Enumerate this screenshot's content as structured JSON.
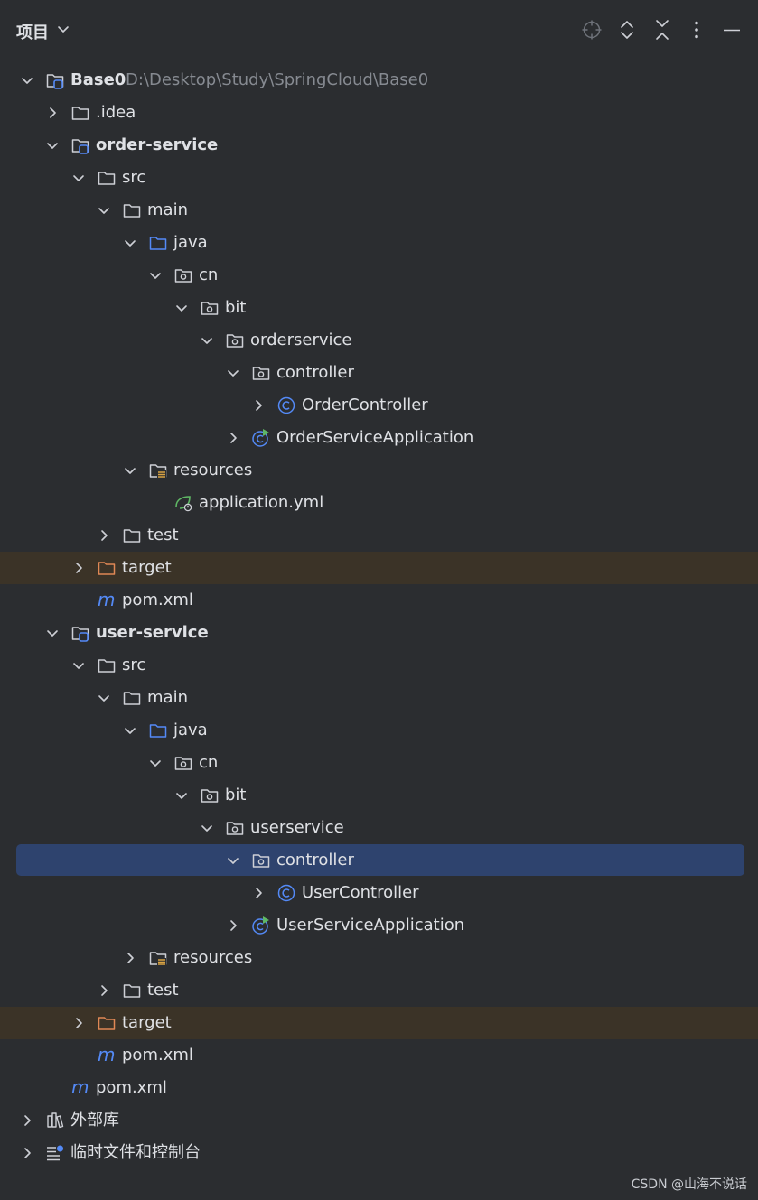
{
  "header": {
    "title": "项目"
  },
  "toolbar_icons": [
    "locate-icon",
    "expand-all-icon",
    "collapse-all-icon",
    "more-options-icon",
    "minimize-icon"
  ],
  "tree": {
    "rows": [
      {
        "label": "Base0",
        "path": "D:\\Desktop\\Study\\SpringCloud\\Base0",
        "bold": true
      },
      {
        "label": ".idea"
      },
      {
        "label": "order-service",
        "bold": true
      },
      {
        "label": "src"
      },
      {
        "label": "main"
      },
      {
        "label": "java"
      },
      {
        "label": "cn"
      },
      {
        "label": "bit"
      },
      {
        "label": "orderservice"
      },
      {
        "label": "controller"
      },
      {
        "label": "OrderController"
      },
      {
        "label": "OrderServiceApplication"
      },
      {
        "label": "resources"
      },
      {
        "label": "application.yml"
      },
      {
        "label": "test"
      },
      {
        "label": "target"
      },
      {
        "label": "pom.xml"
      },
      {
        "label": "user-service",
        "bold": true
      },
      {
        "label": "src"
      },
      {
        "label": "main"
      },
      {
        "label": "java"
      },
      {
        "label": "cn"
      },
      {
        "label": "bit"
      },
      {
        "label": "userservice"
      },
      {
        "label": "controller",
        "selected": true
      },
      {
        "label": "UserController"
      },
      {
        "label": "UserServiceApplication"
      },
      {
        "label": "resources"
      },
      {
        "label": "test"
      },
      {
        "label": "target"
      },
      {
        "label": "pom.xml"
      },
      {
        "label": "pom.xml"
      },
      {
        "label": "外部库"
      },
      {
        "label": "临时文件和控制台"
      }
    ]
  },
  "colors": {
    "background": "#2b2d30",
    "selection": "#2e436e",
    "excluded_row": "#3b3327",
    "folder": "#ced0d6",
    "source_folder": "#548af7",
    "excluded_folder": "#e08855",
    "class_icon": "#548af7",
    "spring_green": "#5fb865"
  },
  "watermark": "CSDN @山海不说话"
}
